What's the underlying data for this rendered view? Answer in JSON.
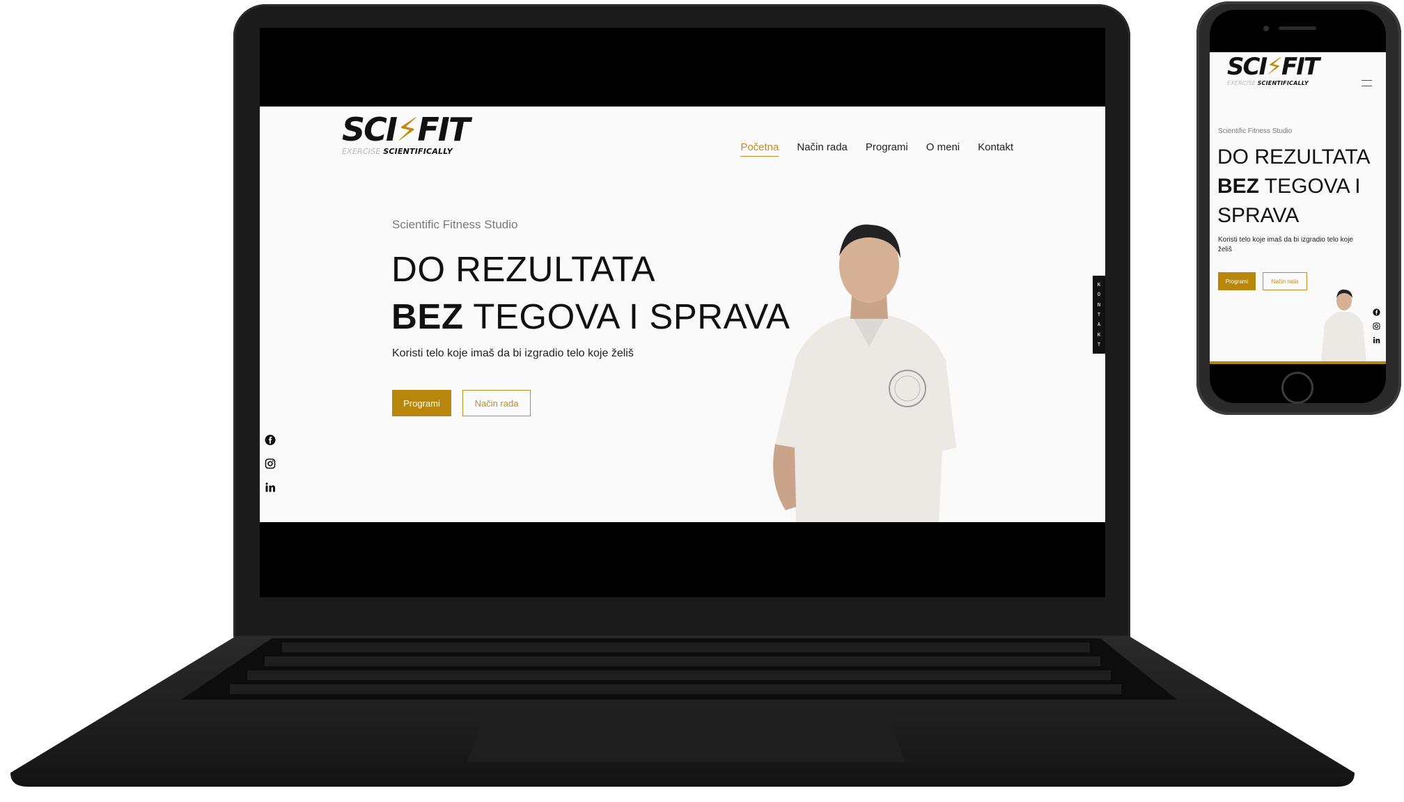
{
  "site": {
    "logo": {
      "main_left": "SCI",
      "main_right": "FIT",
      "tagline_light": "EXERCISE",
      "tagline_dark": "SCIENTIFICALLY"
    },
    "nav": [
      {
        "label": "Početna",
        "active": true
      },
      {
        "label": "Način rada",
        "active": false
      },
      {
        "label": "Programi",
        "active": false
      },
      {
        "label": "O meni",
        "active": false
      },
      {
        "label": "Kontakt",
        "active": false
      }
    ],
    "hero": {
      "subtitle": "Scientific Fitness Studio",
      "title_line1": "DO REZULTATA",
      "title_bold": "BEZ",
      "title_line2_rest": " TEGOVA I SPRAVA",
      "mobile_title_line2_rest": " TEGOVA I",
      "mobile_title_line3": "SPRAVA",
      "description": "Koristi telo koje imaš da bi izgradio telo koje želiš",
      "primary_button": "Programi",
      "secondary_button": "Način rada"
    },
    "kontakt_tab": [
      "K",
      "O",
      "N",
      "T",
      "A",
      "K",
      "T"
    ],
    "socials": [
      "facebook-icon",
      "instagram-icon",
      "linkedin-icon"
    ],
    "colors": {
      "accent": "#b8860b",
      "text": "#111111",
      "background": "#fafafa"
    }
  }
}
